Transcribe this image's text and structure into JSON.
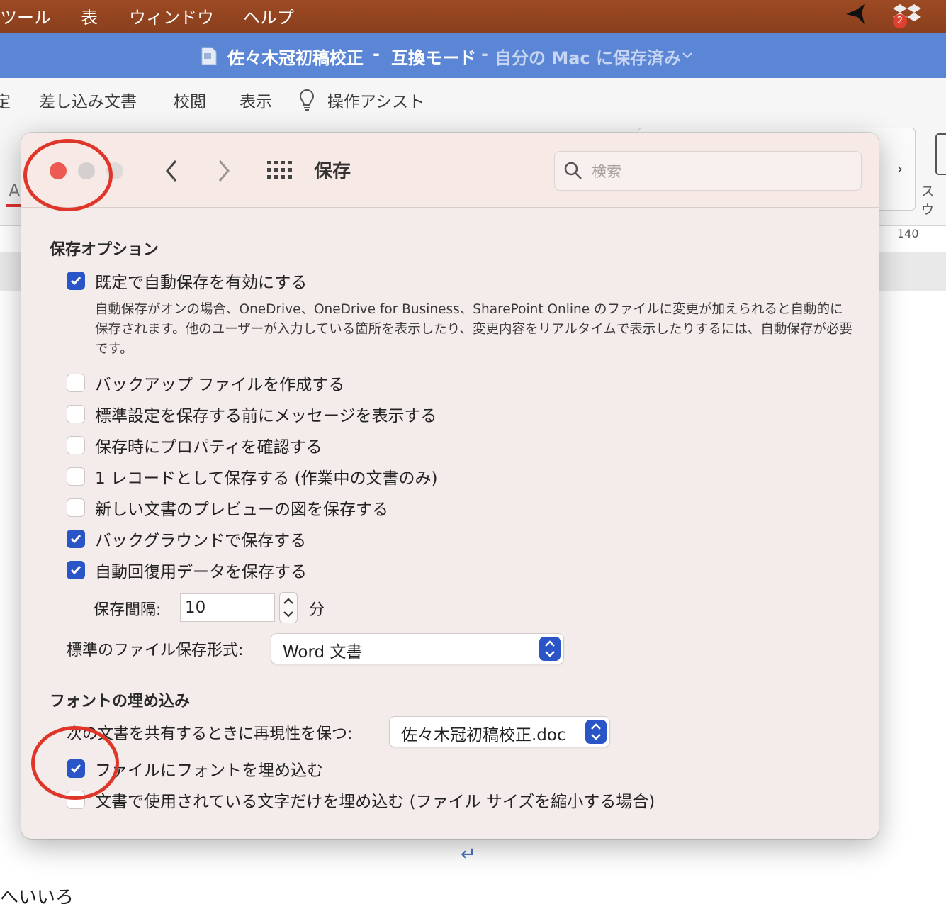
{
  "menubar": {
    "items": [
      "ツール",
      "表",
      "ウィンドウ",
      "ヘルプ"
    ],
    "dropbox_badge": "2"
  },
  "titlebar": {
    "doc_name": "佐々木冠初稿校正",
    "sep1": "-",
    "mode": "互換モード",
    "sep2": "-",
    "status": "自分の Mac に保存済み"
  },
  "ribbon": {
    "tabs": [
      "定",
      "差し込み文書",
      "校閲",
      "表示",
      "操作アシスト"
    ],
    "ruler_number": "140",
    "far_label": "ス ウィ",
    "letter": "A"
  },
  "dialog": {
    "title": "保存",
    "search": {
      "placeholder": "検索"
    },
    "save_options": {
      "title": "保存オプション",
      "autosave_label": "既定で自動保存を有効にする",
      "autosave_checked": true,
      "autosave_desc": "自動保存がオンの場合、OneDrive、OneDrive for Business、SharePoint Online のファイルに変更が加えられると自動的に保存されます。他のユーザーが入力している箇所を表示したり、変更内容をリアルタイムで表示したりするには、自動保存が必要です。",
      "options": [
        {
          "label": "バックアップ ファイルを作成する",
          "checked": false
        },
        {
          "label": "標準設定を保存する前にメッセージを表示する",
          "checked": false
        },
        {
          "label": "保存時にプロパティを確認する",
          "checked": false
        },
        {
          "label": "1 レコードとして保存する (作業中の文書のみ)",
          "checked": false
        },
        {
          "label": "新しい文書のプレビューの図を保存する",
          "checked": false
        },
        {
          "label": "バックグラウンドで保存する",
          "checked": true
        },
        {
          "label": "自動回復用データを保存する",
          "checked": true
        }
      ],
      "interval_label": "保存間隔:",
      "interval_value": "10",
      "interval_unit": "分",
      "format_label": "標準のファイル保存形式:",
      "format_value": "Word 文書"
    },
    "font_embed": {
      "title": "フォントの埋め込み",
      "doc_label": "次の文書を共有するときに再現性を保つ:",
      "doc_value": "佐々木冠初稿校正.doc",
      "embed_label": "ファイルにフォントを埋め込む",
      "embed_checked": true,
      "subset_label": "文書で使用されている文字だけを埋め込む (ファイル サイズを縮小する場合)",
      "subset_checked": false
    }
  },
  "document": {
    "return_mark": "↵",
    "partial_text": "へいいろ"
  },
  "colors": {
    "menubar": "#9c4a23",
    "titlebar": "#5b86d6",
    "checkbox_on": "#2a55c7",
    "annotation": "#e0362a"
  }
}
